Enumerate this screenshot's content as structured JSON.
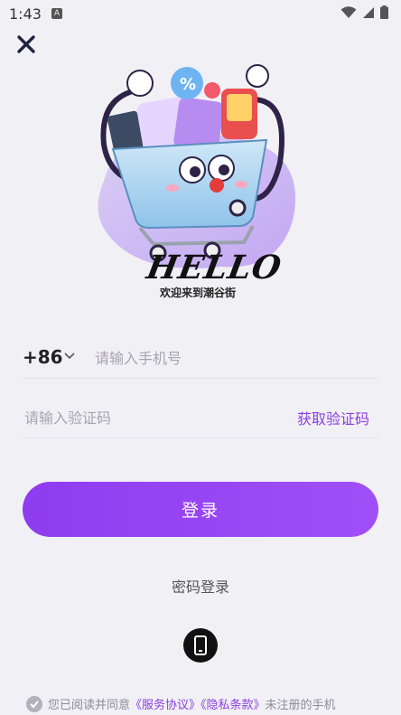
{
  "status_bar": {
    "time": "1:43",
    "notification_letter": "A"
  },
  "hero": {
    "brand_text": "HELLO",
    "welcome_text": "欢迎来到潮谷街"
  },
  "phone": {
    "country_code": "+86",
    "placeholder": "请输入手机号"
  },
  "code": {
    "placeholder": "请输入验证码",
    "get_code_label": "获取验证码"
  },
  "login_button": {
    "label": "登录"
  },
  "password_login": {
    "label": "密码登录"
  },
  "agreement": {
    "prefix": "您已阅读并同意",
    "service_link": "《服务协议》",
    "privacy_link": "《隐私条款》",
    "suffix": "未注册的手机"
  },
  "colors": {
    "accent": "#8a3fe0",
    "background": "#f1f0f5"
  }
}
